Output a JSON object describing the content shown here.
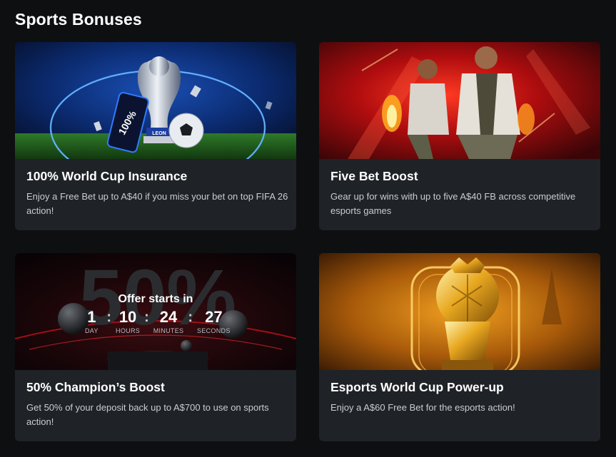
{
  "page": {
    "title": "Sports Bonuses"
  },
  "cards": [
    {
      "title": "100% World Cup Insurance",
      "description": "Enjoy a Free Bet up to A$40 if you miss your bet on top FIFA 26 action!",
      "banner_text": "100%",
      "banner_brand": "LEON"
    },
    {
      "title": "Five Bet Boost",
      "description": "Gear up for wins with up to five A$40 FB across competitive esports games"
    },
    {
      "title": "50% Champion’s Boost",
      "description": "Get 50% of your deposit back up to A$700 to use on sports action!",
      "banner_text": "50%",
      "countdown": {
        "label": "Offer starts in",
        "units": [
          {
            "value": "1",
            "label": "DAY"
          },
          {
            "value": "10",
            "label": "HOURS"
          },
          {
            "value": "24",
            "label": "MINUTES"
          },
          {
            "value": "27",
            "label": "SECONDS"
          }
        ],
        "separator": ":"
      }
    },
    {
      "title": "Esports World Cup Power-up",
      "description": "Enjoy a A$60 Free Bet for the esports action!"
    }
  ],
  "colors": {
    "background": "#0e0f11",
    "card": "#1f2226",
    "text_secondary": "#c9cdd2",
    "accent_blue": "#2f7bff",
    "accent_red": "#e0141b",
    "accent_gold": "#f0a020"
  }
}
